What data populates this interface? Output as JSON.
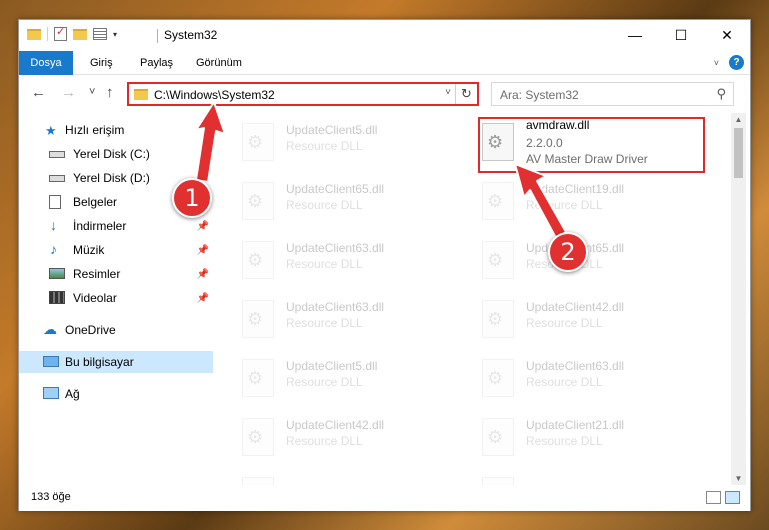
{
  "window": {
    "title": "System32",
    "controls": {
      "minimize": "—",
      "maximize": "☐",
      "close": "✕"
    }
  },
  "ribbon": {
    "tabs": [
      "Dosya",
      "Giriş",
      "Paylaş",
      "Görünüm"
    ],
    "help": "?"
  },
  "nav": {
    "back": "←",
    "forward": "→",
    "recent": "˅",
    "up": "↑",
    "address": "C:\\Windows\\System32",
    "refresh": "↻",
    "search_placeholder": "Ara: System32"
  },
  "sidebar": {
    "items": [
      {
        "label": "Hızlı erişim",
        "icon": "star-icon",
        "pinned": false
      },
      {
        "label": "Yerel Disk (C:)",
        "icon": "drive-icon",
        "pinned": true
      },
      {
        "label": "Yerel Disk (D:)",
        "icon": "drive-icon",
        "pinned": true
      },
      {
        "label": "Belgeler",
        "icon": "document-icon",
        "pinned": true
      },
      {
        "label": "İndirmeler",
        "icon": "download-icon",
        "pinned": true
      },
      {
        "label": "Müzik",
        "icon": "music-icon",
        "pinned": true
      },
      {
        "label": "Resimler",
        "icon": "pictures-icon",
        "pinned": true
      },
      {
        "label": "Videolar",
        "icon": "video-icon",
        "pinned": true
      },
      {
        "label": "OneDrive",
        "icon": "cloud-icon",
        "pinned": false
      },
      {
        "label": "Bu bilgisayar",
        "icon": "computer-icon",
        "pinned": false,
        "selected": true
      },
      {
        "label": "Ağ",
        "icon": "network-icon",
        "pinned": false
      }
    ],
    "pin_glyph": "📌"
  },
  "files": {
    "left": [
      {
        "name": "UpdateClient5.dll",
        "desc": "Resource DLL"
      },
      {
        "name": "UpdateClient65.dll",
        "desc": "Resource DLL"
      },
      {
        "name": "UpdateClient63.dll",
        "desc": "Resource DLL"
      },
      {
        "name": "UpdateClient63.dll",
        "desc": "Resource DLL"
      },
      {
        "name": "UpdateClient5.dll",
        "desc": "Resource DLL"
      },
      {
        "name": "UpdateClient42.dll",
        "desc": "Resource DLL"
      },
      {
        "name": "",
        "desc": ""
      }
    ],
    "right": [
      {
        "name": "avmdraw.dll",
        "desc": "2.2.0.0",
        "extra": "AV Master Draw Driver",
        "highlighted": true
      },
      {
        "name": "UpdateClient19.dll",
        "desc": "Resource DLL"
      },
      {
        "name": "UpdateClient65.dll",
        "desc": "Resource DLL"
      },
      {
        "name": "UpdateClient42.dll",
        "desc": "Resource DLL"
      },
      {
        "name": "UpdateClient63.dll",
        "desc": "Resource DLL"
      },
      {
        "name": "UpdateClient21.dll",
        "desc": "Resource DLL"
      },
      {
        "name": "",
        "desc": ""
      }
    ]
  },
  "status": {
    "count": "133 öğe"
  },
  "annotations": {
    "step1": "1",
    "step2": "2",
    "color": "#e0302f"
  }
}
